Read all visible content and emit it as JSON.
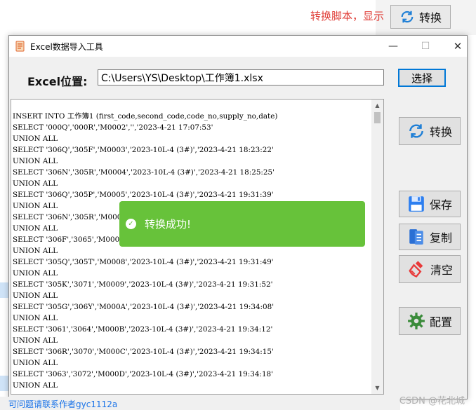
{
  "background": {
    "caption": "转换脚本，显示",
    "convert_button_label": "转换",
    "status_link": "可问题请联系作者gyc1112a",
    "watermark": "CSDN @花北城"
  },
  "window": {
    "title": "Excel数据导入工具",
    "controls": {
      "minimize": "—",
      "maximize": "☐",
      "close": "✕"
    },
    "path": {
      "label": "Excel位置:",
      "value": "C:\\Users\\YS\\Desktop\\工作簿1.xlsx"
    },
    "browse_label": "选择",
    "sql_lines": [
      "INSERT INTO 工作簿1 (first_code,second_code,code_no,supply_no,date)",
      "SELECT '000Q','000R','M0002','','2023-4-21 17:07:53'",
      "UNION ALL",
      "SELECT '306Q','305F','M0003','2023-10L-4 (3#)','2023-4-21 18:23:22'",
      "UNION ALL",
      "SELECT '306N','305R','M0004','2023-10L-4 (3#)','2023-4-21 18:25:25'",
      "UNION ALL",
      "SELECT '306Q','305P','M0005','2023-10L-4 (3#)','2023-4-21 19:31:39'",
      "UNION ALL",
      "SELECT '306N','305R','M000",
      "UNION ALL",
      "SELECT '306F','3065','M000",
      "UNION ALL",
      "SELECT '305Q','305T','M0008','2023-10L-4 (3#)','2023-4-21 19:31:49'",
      "UNION ALL",
      "SELECT '305K','3071','M0009','2023-10L-4 (3#)','2023-4-21 19:31:52'",
      "UNION ALL",
      "SELECT '305G','306Y','M000A','2023-10L-4 (3#)','2023-4-21 19:34:08'",
      "UNION ALL",
      "SELECT '3061','3064','M000B','2023-10L-4 (3#)','2023-4-21 19:34:12'",
      "UNION ALL",
      "SELECT '306R','3070','M000C','2023-10L-4 (3#)','2023-4-21 19:34:15'",
      "UNION ALL",
      "SELECT '3063','3072','M000D','2023-10L-4 (3#)','2023-4-21 19:34:18'",
      "UNION ALL"
    ],
    "side_buttons": {
      "convert": {
        "label": "转换",
        "icon": "refresh-icon"
      },
      "save": {
        "label": "保存",
        "icon": "floppy-icon"
      },
      "copy": {
        "label": "复制",
        "icon": "document-icon"
      },
      "clear": {
        "label": "清空",
        "icon": "broom-icon"
      },
      "config": {
        "label": "配置",
        "icon": "gear-icon"
      }
    }
  },
  "toast": {
    "message": "转换成功!",
    "color": "#67c23a"
  }
}
